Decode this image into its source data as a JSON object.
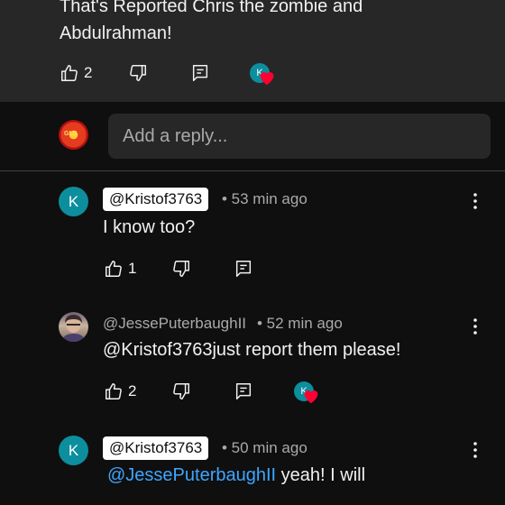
{
  "top_comment": {
    "text_line1": "That's Reported Chris the zombie and",
    "text_line2": "Abdulrahman!",
    "like_count": "2",
    "heart_avatar_letter": "K"
  },
  "reply_box": {
    "placeholder": "Add a reply...",
    "avatar_text": "GLS"
  },
  "replies": [
    {
      "avatar_letter": "K",
      "handle": "@Kristof3763",
      "time": "• 53 min ago",
      "text": "I know too?",
      "like_count": "1"
    },
    {
      "handle": "@JessePuterbaughII",
      "time": "• 52 min ago",
      "text": "@Kristof3763just report them please!",
      "like_count": "2",
      "heart_avatar_letter": "K"
    },
    {
      "avatar_letter": "K",
      "handle": "@Kristof3763",
      "time": "• 50 min ago",
      "mention": "@JessePuterbaughII",
      "text": " yeah! I will"
    }
  ],
  "colors": {
    "background": "#0f0f0f",
    "surface": "#272727",
    "accent_mention": "#3ea6ff",
    "avatar_teal": "#0c8e9d",
    "heart": "#ff0033"
  },
  "icons": [
    "thumb-up-icon",
    "thumb-down-icon",
    "reply-icon",
    "more-vert-icon",
    "heart-icon"
  ]
}
